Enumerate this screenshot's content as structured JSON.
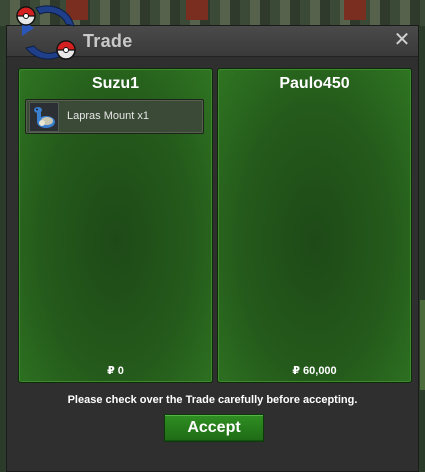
{
  "window": {
    "title": "Trade",
    "close_icon": "close-icon",
    "logo_icon": "pokeball-arrows-logo"
  },
  "trade": {
    "left": {
      "player_name": "Suzu1",
      "items": [
        {
          "label": "Lapras Mount  x1",
          "icon": "lapras-icon"
        }
      ],
      "currency_symbol": "₽",
      "money_text": "₽ 0"
    },
    "right": {
      "player_name": "Paulo450",
      "items": [],
      "currency_symbol": "₽",
      "money_text": "₽ 60,000"
    }
  },
  "footer": {
    "notice": "Please check over the Trade carefully before accepting.",
    "accept_label": "Accept"
  },
  "colors": {
    "panel_green": "#245a1b",
    "accept_green": "#2f8f22",
    "window_bg": "#2f2f2f"
  }
}
